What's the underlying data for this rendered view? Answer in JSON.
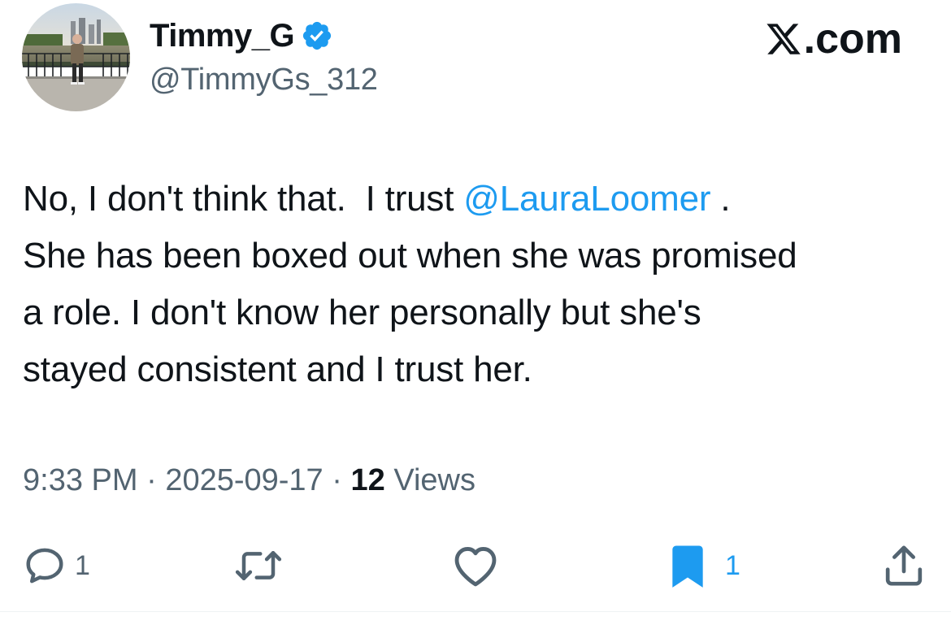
{
  "author": {
    "display_name": "Timmy_G",
    "handle": "@TimmyGs_312",
    "verified": true,
    "verified_color": "#1d9bf0"
  },
  "site_mark": ".com",
  "tweet": {
    "lines": [
      {
        "before": "No, I don't think that.  I trust ",
        "mention": "@LauraLoomer",
        "after": " ."
      },
      {
        "text": "She has been boxed out when she was promised"
      },
      {
        "text": "a role. I don't know her personally but she's"
      },
      {
        "text": "stayed consistent and I trust her."
      }
    ]
  },
  "meta": {
    "time": "9:33 PM",
    "separator": " · ",
    "date": "2025-09-17",
    "views_count": "12",
    "views_label": " Views"
  },
  "actions": {
    "reply_count": "1",
    "retweet_count": "",
    "like_count": "",
    "bookmark_count": "1",
    "bookmark_color": "#1d9bf0"
  },
  "colors": {
    "text_primary": "#0f1419",
    "text_secondary": "#536471",
    "accent": "#1d9bf0"
  }
}
